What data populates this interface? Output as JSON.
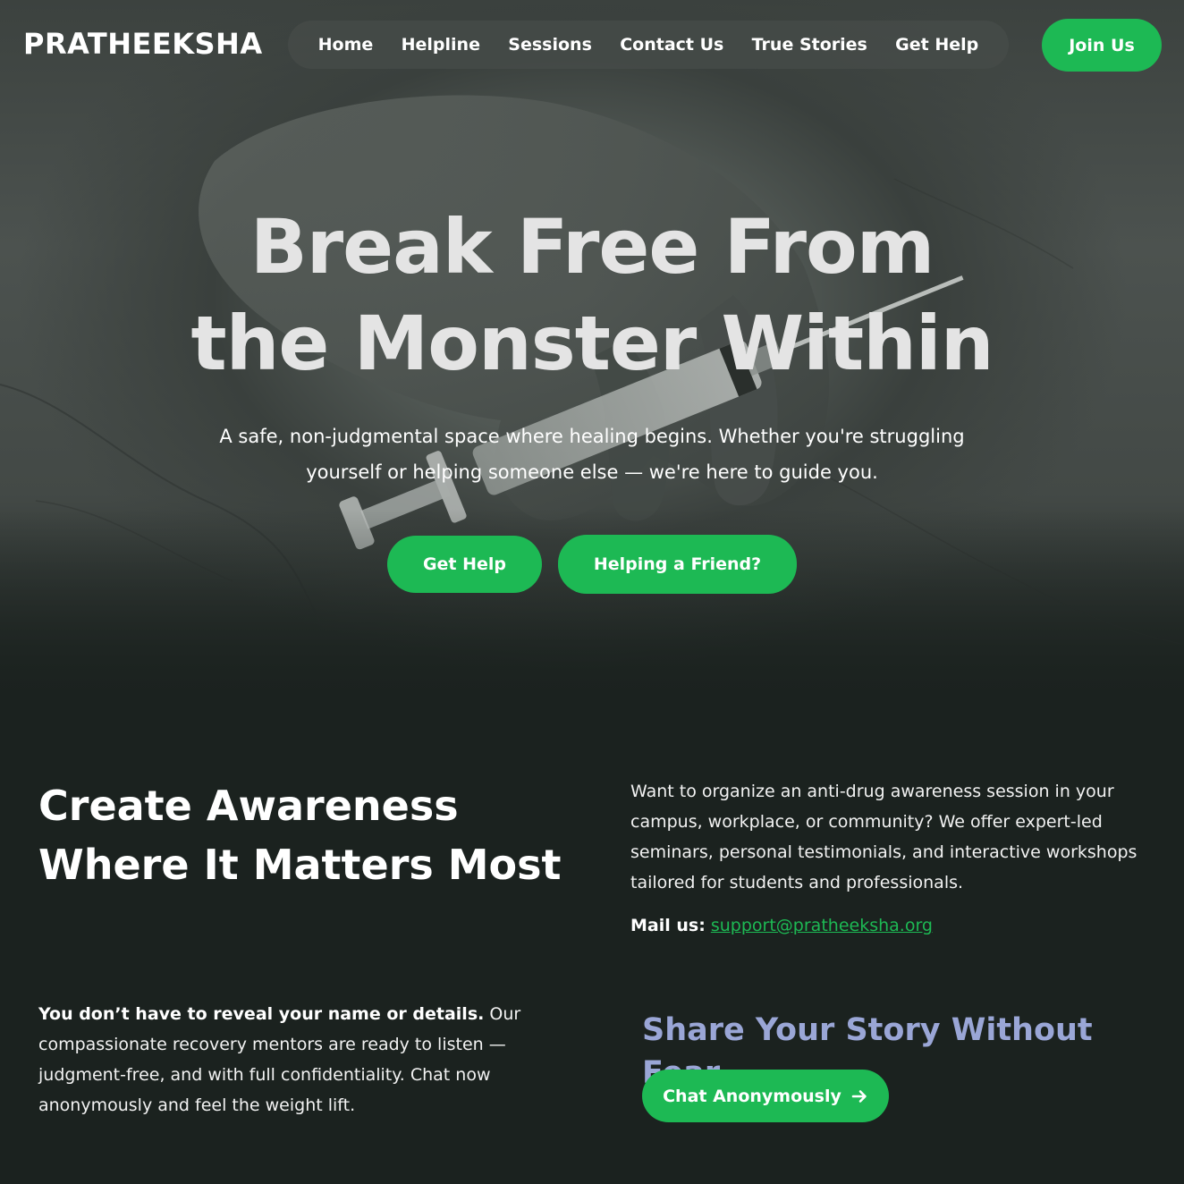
{
  "brand": {
    "logo": "PRATHEEKSHA"
  },
  "nav": {
    "items": [
      {
        "label": "Home"
      },
      {
        "label": "Helpline"
      },
      {
        "label": "Sessions"
      },
      {
        "label": "Contact Us"
      },
      {
        "label": "True Stories"
      },
      {
        "label": "Get Help"
      }
    ],
    "join_label": "Join Us"
  },
  "hero": {
    "title_line1": "Break Free From",
    "title_line2": "the Monster Within",
    "subtitle": "A safe, non-judgmental space where healing begins. Whether you're struggling yourself or helping someone else — we're here to guide you.",
    "get_help_label": "Get Help",
    "friend_label": "Helping a Friend?"
  },
  "awareness": {
    "title": "Create Awareness Where It Matters Most",
    "text": "Want to organize an anti-drug awareness session in your campus, workplace, or community? We offer expert-led seminars, personal testimonials, and interactive workshops tailored for students and professionals.",
    "mail_label": "Mail us:",
    "mail_address": "support@pratheeksha.org"
  },
  "anonymous": {
    "bold_text": "You don’t have to reveal your name or details.",
    "text": " Our compassionate recovery mentors are ready to listen — judgment-free, and with full confidentiality. Chat now anonymously and feel the weight lift.",
    "share_title": "Share Your Story Without Fear",
    "chat_label": "Chat Anonymously",
    "chat_icon": "arrow-right-icon"
  },
  "colors": {
    "accent": "#1db954",
    "background": "#1b221f",
    "share_title": "#9aa6d6"
  }
}
